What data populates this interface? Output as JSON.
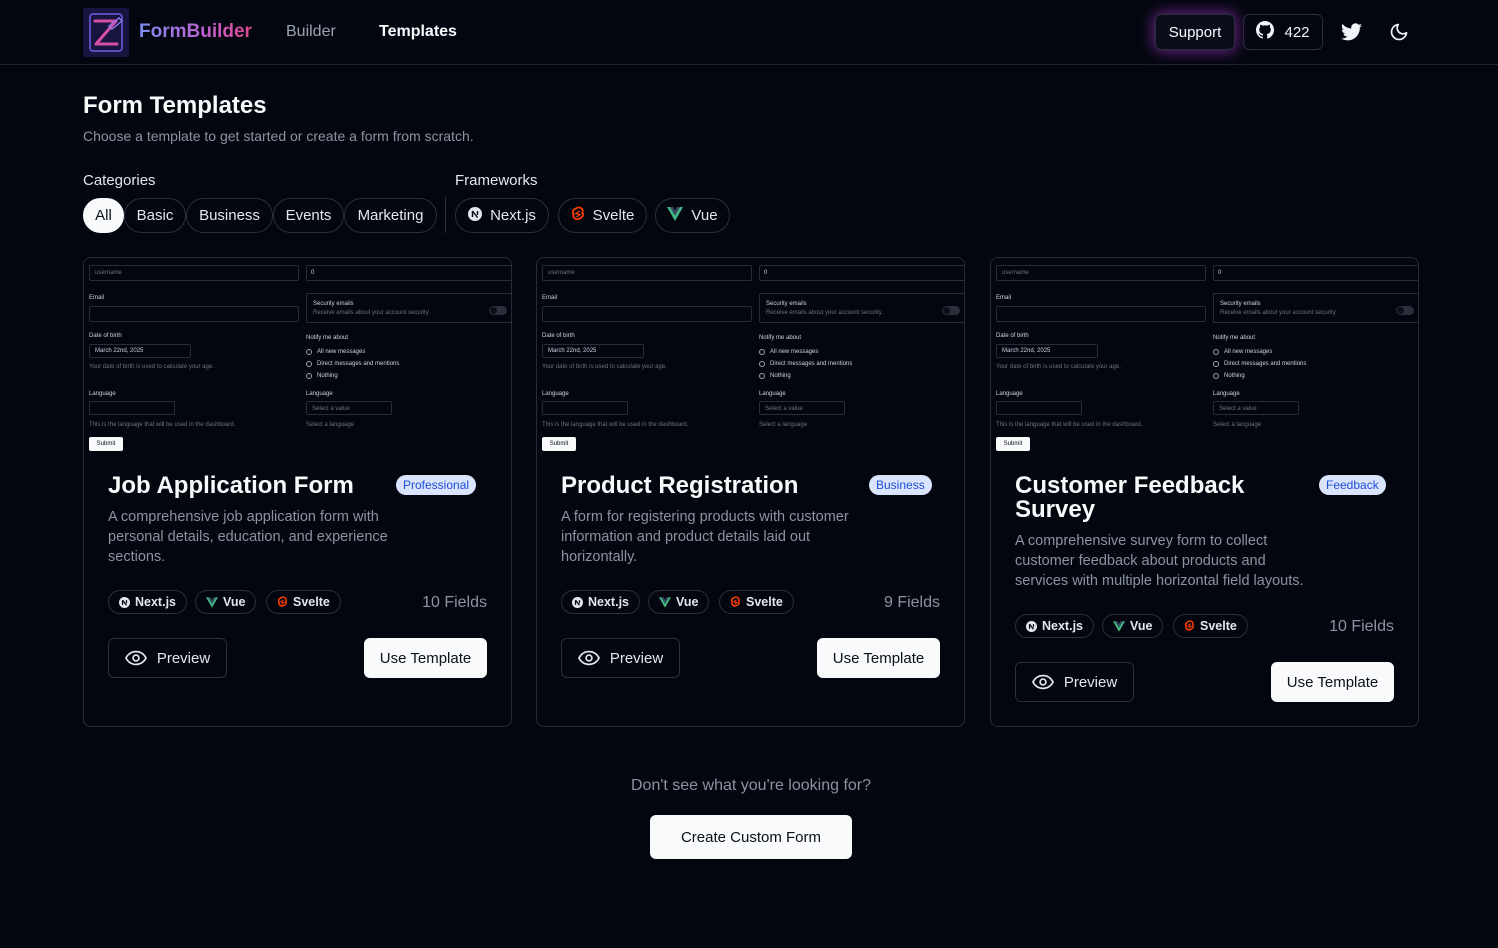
{
  "header": {
    "brand": "FormBuilder",
    "nav": [
      {
        "label": "Builder",
        "active": false
      },
      {
        "label": "Templates",
        "active": true
      }
    ],
    "support_label": "Support",
    "github_stars": "422"
  },
  "page": {
    "title": "Form Templates",
    "subtitle": "Choose a template to get started or create a form from scratch."
  },
  "filters": {
    "categories_label": "Categories",
    "categories": [
      "All",
      "Basic",
      "Business",
      "Events",
      "Marketing"
    ],
    "selected_category": "All",
    "frameworks_label": "Frameworks",
    "frameworks": [
      "Next.js",
      "Svelte",
      "Vue"
    ]
  },
  "preview_form": {
    "username_placeholder": "username",
    "number_value": "0",
    "email_label": "Email",
    "security_title": "Security emails",
    "security_desc": "Receive emails about your account security.",
    "dob_label": "Date of birth",
    "dob_value": "March 22nd, 2025",
    "dob_hint": "Your date of birth is used to calculate your age.",
    "notify_label": "Notify me about",
    "notify_options": [
      "All new messages",
      "Direct messages and mentions",
      "Nothing"
    ],
    "language_label": "Language",
    "language_hint": "This is the language that will be used in the dashboard.",
    "language2_label": "Language",
    "select_placeholder": "Select a value",
    "select_hint": "Select a language",
    "submit": "Submit"
  },
  "cards": [
    {
      "title": "Job Application Form",
      "badge": "Professional",
      "description": "A comprehensive job application form with personal details, education, and experience sections.",
      "frameworks": [
        "Next.js",
        "Vue",
        "Svelte"
      ],
      "fields": "10 Fields",
      "preview_label": "Preview",
      "use_label": "Use Template"
    },
    {
      "title": "Product Registration",
      "badge": "Business",
      "description": "A form for registering products with customer information and product details laid out horizontally.",
      "frameworks": [
        "Next.js",
        "Vue",
        "Svelte"
      ],
      "fields": "9 Fields",
      "preview_label": "Preview",
      "use_label": "Use Template"
    },
    {
      "title": "Customer Feedback Survey",
      "badge": "Feedback",
      "description": "A comprehensive survey form to collect customer feedback about products and services with multiple horizontal field layouts.",
      "frameworks": [
        "Next.js",
        "Vue",
        "Svelte"
      ],
      "fields": "10 Fields",
      "preview_label": "Preview",
      "use_label": "Use Template"
    }
  ],
  "footer_cta": {
    "question": "Don't see what you're looking for?",
    "button": "Create Custom Form"
  },
  "colors": {
    "background": "#03060f",
    "badge_bg": "#dbe4fd",
    "badge_text": "#1d4ed8",
    "svelte": "#ff3e00",
    "vue": "#41b883"
  }
}
